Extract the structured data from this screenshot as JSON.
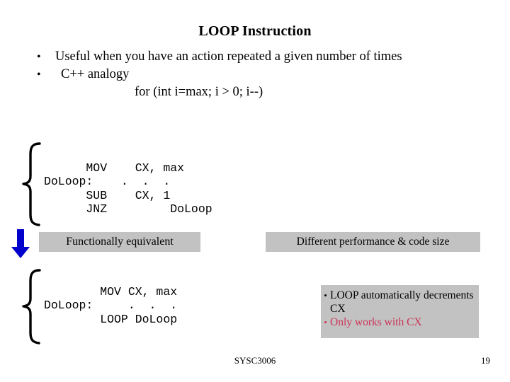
{
  "slide": {
    "title": "LOOP Instruction",
    "bullets": [
      {
        "glyph": "•",
        "text": "Useful when you have an action repeated a given number of times"
      },
      {
        "glyph": "•",
        "text": "C++ analogy",
        "sub_line": "for (int i=max; i > 0; i--)"
      }
    ],
    "code_block_1": "      MOV    CX, max\nDoLoop:    .  .  .\n      SUB    CX, 1\n      JNZ         DoLoop",
    "code_block_2": "        MOV CX, max\nDoLoop:     .  .  .\n        LOOP DoLoop",
    "banner_equivalent": "Functionally equivalent",
    "banner_performance": "Different performance & code size",
    "callout": {
      "items": [
        {
          "glyph": "•",
          "text": "LOOP automatically decrements CX",
          "color": "#000000"
        },
        {
          "glyph": "•",
          "text": "Only works with CX",
          "color": "#cc3355"
        }
      ]
    },
    "footer": {
      "course": "SYSC3006",
      "page_number": "19"
    },
    "colors": {
      "arrow": "#0000cc",
      "box_background": "#c2c2c2",
      "highlight_text": "#cc3355",
      "body_text": "#000000",
      "slide_background": "#ffffff"
    }
  }
}
